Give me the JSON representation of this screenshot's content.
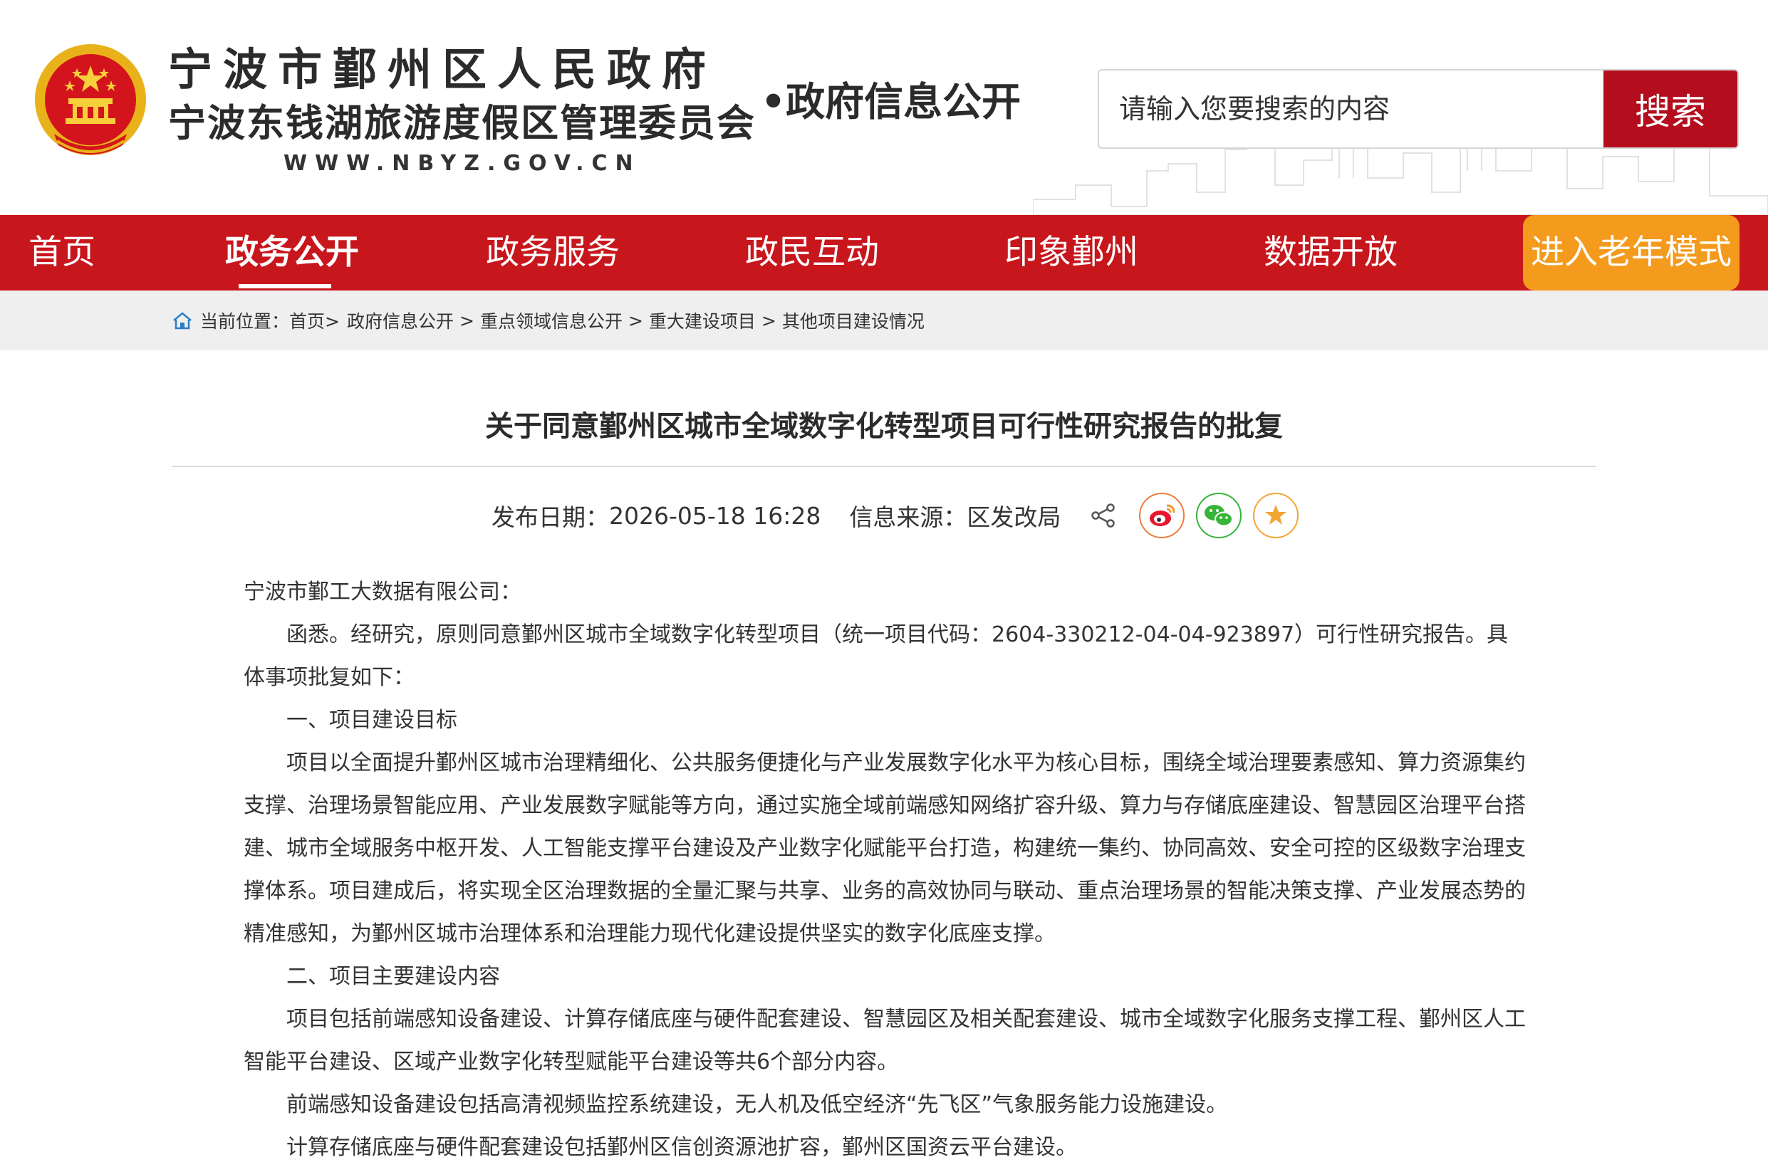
{
  "header": {
    "title_line1": "宁波市鄞州区人民政府",
    "title_line2": "宁波东钱湖旅游度假区管理委员会",
    "url": "WWW.NBYZ.GOV.CN",
    "subtitle": "•政府信息公开",
    "search": {
      "placeholder": "请输入您要搜索的内容",
      "button_label": "搜索"
    }
  },
  "nav": {
    "items": [
      {
        "label": "首页"
      },
      {
        "label": "政务公开"
      },
      {
        "label": "政务服务"
      },
      {
        "label": "政民互动"
      },
      {
        "label": "印象鄞州"
      },
      {
        "label": "数据开放"
      }
    ],
    "active_index": 1,
    "elder_mode_label": "进入老年模式"
  },
  "breadcrumb": {
    "prefix": "当前位置：",
    "items": [
      "首页>",
      "政府信息公开",
      "重点领域信息公开",
      "重大建设项目",
      "其他项目建设情况"
    ],
    "separator": ">"
  },
  "article": {
    "title": "关于同意鄞州区城市全域数字化转型项目可行性研究报告的批复",
    "publish_label": "发布日期：",
    "publish_date": "2026-05-18 16:28",
    "source_label": "信息来源：",
    "source": "区发改局",
    "paragraphs": [
      "宁波市鄞工大数据有限公司：",
      "函悉。经研究，原则同意鄞州区城市全域数字化转型项目（统一项目代码：2604-330212-04-04-923897）可行性研究报告。具体事项批复如下：",
      "一、项目建设目标",
      "项目以全面提升鄞州区城市治理精细化、公共服务便捷化与产业发展数字化水平为核心目标，围绕全域治理要素感知、算力资源集约支撑、治理场景智能应用、产业发展数字赋能等方向，通过实施全域前端感知网络扩容升级、算力与存储底座建设、智慧园区治理平台搭建、城市全域服务中枢开发、人工智能支撑平台建设及产业数字化赋能平台打造，构建统一集约、协同高效、安全可控的区级数字治理支撑体系。项目建成后，将实现全区治理数据的全量汇聚与共享、业务的高效协同与联动、重点治理场景的智能决策支撑、产业发展态势的精准感知，为鄞州区城市治理体系和治理能力现代化建设提供坚实的数字化底座支撑。",
      "二、项目主要建设内容",
      "项目包括前端感知设备建设、计算存储底座与硬件配套建设、智慧园区及相关配套建设、城市全域数字化服务支撑工程、鄞州区人工智能平台建设、区域产业数字化转型赋能平台建设等共6个部分内容。",
      "前端感知设备建设包括高清视频监控系统建设，无人机及低空经济“先飞区”气象服务能力设施建设。",
      "计算存储底座与硬件配套建设包括鄞州区信创资源池扩容，鄞州区国资云平台建设。"
    ]
  },
  "icons": {
    "emblem": "national-emblem-icon",
    "home": "home-icon",
    "share": "share-icon",
    "weibo": "weibo-icon",
    "wechat": "wechat-icon",
    "favorite": "star-icon"
  },
  "colors": {
    "nav_bg": "#c8161d",
    "search_button": "#b30d1e",
    "elder_button": "#f49a1d",
    "breadcrumb_bg": "#efefef"
  }
}
